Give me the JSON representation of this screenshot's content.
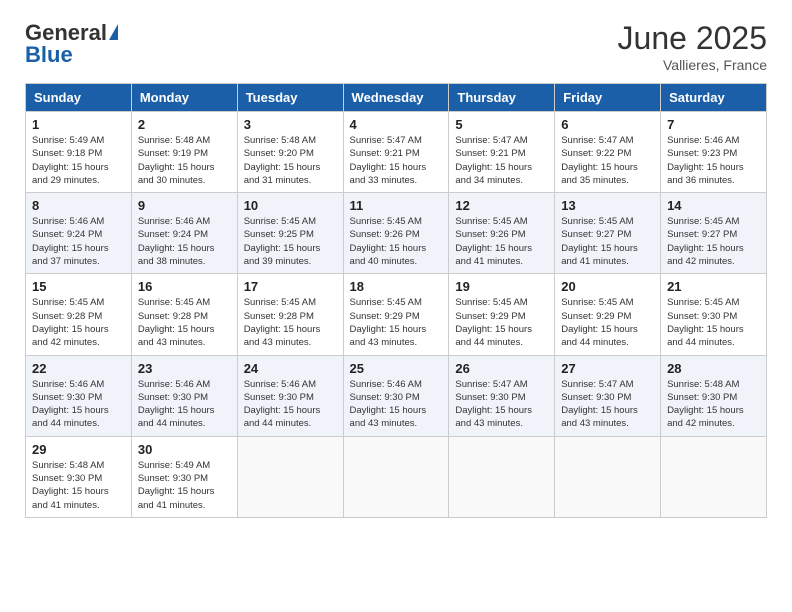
{
  "header": {
    "logo_general": "General",
    "logo_blue": "Blue",
    "month": "June 2025",
    "location": "Vallieres, France"
  },
  "days_of_week": [
    "Sunday",
    "Monday",
    "Tuesday",
    "Wednesday",
    "Thursday",
    "Friday",
    "Saturday"
  ],
  "weeks": [
    [
      {
        "day": "1",
        "sunrise": "5:49 AM",
        "sunset": "9:18 PM",
        "daylight": "15 hours and 29 minutes."
      },
      {
        "day": "2",
        "sunrise": "5:48 AM",
        "sunset": "9:19 PM",
        "daylight": "15 hours and 30 minutes."
      },
      {
        "day": "3",
        "sunrise": "5:48 AM",
        "sunset": "9:20 PM",
        "daylight": "15 hours and 31 minutes."
      },
      {
        "day": "4",
        "sunrise": "5:47 AM",
        "sunset": "9:21 PM",
        "daylight": "15 hours and 33 minutes."
      },
      {
        "day": "5",
        "sunrise": "5:47 AM",
        "sunset": "9:21 PM",
        "daylight": "15 hours and 34 minutes."
      },
      {
        "day": "6",
        "sunrise": "5:47 AM",
        "sunset": "9:22 PM",
        "daylight": "15 hours and 35 minutes."
      },
      {
        "day": "7",
        "sunrise": "5:46 AM",
        "sunset": "9:23 PM",
        "daylight": "15 hours and 36 minutes."
      }
    ],
    [
      {
        "day": "8",
        "sunrise": "5:46 AM",
        "sunset": "9:24 PM",
        "daylight": "15 hours and 37 minutes."
      },
      {
        "day": "9",
        "sunrise": "5:46 AM",
        "sunset": "9:24 PM",
        "daylight": "15 hours and 38 minutes."
      },
      {
        "day": "10",
        "sunrise": "5:45 AM",
        "sunset": "9:25 PM",
        "daylight": "15 hours and 39 minutes."
      },
      {
        "day": "11",
        "sunrise": "5:45 AM",
        "sunset": "9:26 PM",
        "daylight": "15 hours and 40 minutes."
      },
      {
        "day": "12",
        "sunrise": "5:45 AM",
        "sunset": "9:26 PM",
        "daylight": "15 hours and 41 minutes."
      },
      {
        "day": "13",
        "sunrise": "5:45 AM",
        "sunset": "9:27 PM",
        "daylight": "15 hours and 41 minutes."
      },
      {
        "day": "14",
        "sunrise": "5:45 AM",
        "sunset": "9:27 PM",
        "daylight": "15 hours and 42 minutes."
      }
    ],
    [
      {
        "day": "15",
        "sunrise": "5:45 AM",
        "sunset": "9:28 PM",
        "daylight": "15 hours and 42 minutes."
      },
      {
        "day": "16",
        "sunrise": "5:45 AM",
        "sunset": "9:28 PM",
        "daylight": "15 hours and 43 minutes."
      },
      {
        "day": "17",
        "sunrise": "5:45 AM",
        "sunset": "9:28 PM",
        "daylight": "15 hours and 43 minutes."
      },
      {
        "day": "18",
        "sunrise": "5:45 AM",
        "sunset": "9:29 PM",
        "daylight": "15 hours and 43 minutes."
      },
      {
        "day": "19",
        "sunrise": "5:45 AM",
        "sunset": "9:29 PM",
        "daylight": "15 hours and 44 minutes."
      },
      {
        "day": "20",
        "sunrise": "5:45 AM",
        "sunset": "9:29 PM",
        "daylight": "15 hours and 44 minutes."
      },
      {
        "day": "21",
        "sunrise": "5:45 AM",
        "sunset": "9:30 PM",
        "daylight": "15 hours and 44 minutes."
      }
    ],
    [
      {
        "day": "22",
        "sunrise": "5:46 AM",
        "sunset": "9:30 PM",
        "daylight": "15 hours and 44 minutes."
      },
      {
        "day": "23",
        "sunrise": "5:46 AM",
        "sunset": "9:30 PM",
        "daylight": "15 hours and 44 minutes."
      },
      {
        "day": "24",
        "sunrise": "5:46 AM",
        "sunset": "9:30 PM",
        "daylight": "15 hours and 44 minutes."
      },
      {
        "day": "25",
        "sunrise": "5:46 AM",
        "sunset": "9:30 PM",
        "daylight": "15 hours and 43 minutes."
      },
      {
        "day": "26",
        "sunrise": "5:47 AM",
        "sunset": "9:30 PM",
        "daylight": "15 hours and 43 minutes."
      },
      {
        "day": "27",
        "sunrise": "5:47 AM",
        "sunset": "9:30 PM",
        "daylight": "15 hours and 43 minutes."
      },
      {
        "day": "28",
        "sunrise": "5:48 AM",
        "sunset": "9:30 PM",
        "daylight": "15 hours and 42 minutes."
      }
    ],
    [
      {
        "day": "29",
        "sunrise": "5:48 AM",
        "sunset": "9:30 PM",
        "daylight": "15 hours and 41 minutes."
      },
      {
        "day": "30",
        "sunrise": "5:49 AM",
        "sunset": "9:30 PM",
        "daylight": "15 hours and 41 minutes."
      },
      null,
      null,
      null,
      null,
      null
    ]
  ]
}
